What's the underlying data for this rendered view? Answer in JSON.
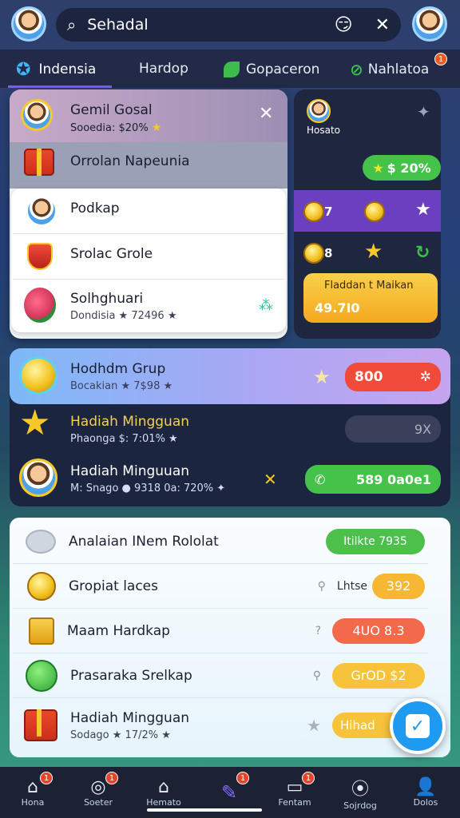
{
  "header": {
    "search_text": "Sehadal",
    "emoji": "😏",
    "close": "✕"
  },
  "tabs": [
    {
      "label": "Indensia",
      "icon": "star-icon"
    },
    {
      "label": "Hardop",
      "icon": ""
    },
    {
      "label": "Gopaceron",
      "icon": "leaf-icon"
    },
    {
      "label": "Nahlatoa",
      "icon": "check-icon",
      "badge": "1"
    }
  ],
  "popup": {
    "title": "Gemil Gosal",
    "subtitle": "Sooedia: $20%",
    "close": "✕",
    "items": [
      {
        "label": "Orrolan Napeunia"
      },
      {
        "label": "Podkap"
      },
      {
        "label": "Srolac Grole"
      },
      {
        "label": "Solhghuari",
        "sub": "Dondisia  ★  72496 ★"
      }
    ]
  },
  "side_card": {
    "name": "Hosato",
    "stat_green": "$ 20%",
    "row1_num": "7",
    "row2_num": "8",
    "cta_title": "Fladdan t Maikan",
    "cta_value": "49.7I0"
  },
  "group_card": {
    "title": "Hodhdm Grup",
    "sub": "Bocakian ★ 7$98 ★",
    "btn_value": "800"
  },
  "weekly": {
    "title": "Hadiah Mingguan",
    "sub": "Phaonga $: 7:01% ★",
    "box_value": "9X"
  },
  "weekly2": {
    "title": "Hadiah Minguuan",
    "sub": "M: Snago  ●  9318 0a: 720% ✦",
    "btn_value": "589 0a0e1"
  },
  "list": [
    {
      "label": "Analaian INem Rololat",
      "right_label": "",
      "chip": "Itilkte  7935",
      "chip_color": "#4cc04a"
    },
    {
      "label": "Gropiat laces",
      "right_label": "Lhtse",
      "chip": "392",
      "chip_color": "#f7b733"
    },
    {
      "label": "Maam Hardkap",
      "right_label": "",
      "chip": "4UO  8.3",
      "chip_color": "#f26a4b"
    },
    {
      "label": "Prasaraka Srelkap",
      "right_label": "",
      "chip": "GrOD  $2",
      "chip_color": "#f7c33a"
    },
    {
      "label": "Hadiah Mingguan",
      "sub": "Sodago ★ 17/2% ★",
      "right_label": "",
      "chip": "Hihad",
      "chip_color": "#f7c33a"
    }
  ],
  "bottom_nav": [
    {
      "label": "Hona",
      "icon": "home-icon",
      "badge": "1"
    },
    {
      "label": "Soeter",
      "icon": "globe-icon",
      "badge": "1"
    },
    {
      "label": "Hemato",
      "icon": "house-icon",
      "badge": ""
    },
    {
      "label": "",
      "icon": "edit-icon",
      "badge": "1"
    },
    {
      "label": "Fentam",
      "icon": "card-icon",
      "badge": "1"
    },
    {
      "label": "Sojrdog",
      "icon": "record-icon",
      "badge": ""
    },
    {
      "label": "Dolos",
      "icon": "user-icon",
      "badge": ""
    }
  ]
}
